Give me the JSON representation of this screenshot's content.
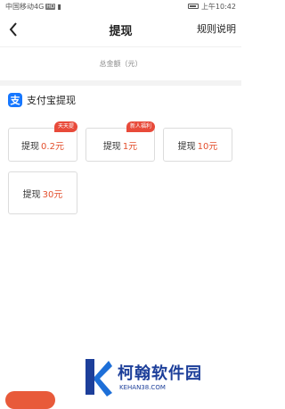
{
  "status_bar": {
    "carrier": "中国移动4G",
    "hd_badge": "HD",
    "time": "上午10:42"
  },
  "app_bar": {
    "back_icon": "chevron-left-icon",
    "title": "提现",
    "rules_link": "规则说明"
  },
  "summary": {
    "total_label": "总金额（元）"
  },
  "alipay_section": {
    "icon_char": "支",
    "title": "支付宝提现",
    "options": [
      {
        "label": "提现",
        "amount": "0.2元",
        "tag": "天天提"
      },
      {
        "label": "提现",
        "amount": "1元",
        "tag": "新人福利"
      },
      {
        "label": "提现",
        "amount": "10元",
        "tag": ""
      },
      {
        "label": "提现",
        "amount": "30元",
        "tag": ""
      }
    ]
  },
  "watermark": {
    "name": "柯翰软件园",
    "url": "KEHAN38.COM"
  },
  "colors": {
    "accent": "#e3502e",
    "tag_bg": "#e84a3a",
    "alipay_blue": "#1677ff"
  }
}
